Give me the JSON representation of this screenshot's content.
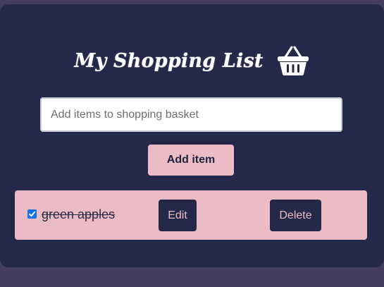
{
  "header": {
    "title": "My Shopping List",
    "icon": "basket-icon"
  },
  "form": {
    "input_value": "",
    "input_placeholder": "Add items to shopping basket",
    "add_label": "Add item"
  },
  "items": [
    {
      "text": "green apples",
      "checked": true,
      "edit_label": "Edit",
      "delete_label": "Delete"
    }
  ],
  "colors": {
    "page_background": "#453c62",
    "card_background": "#242849",
    "accent_pink": "#ecbcc6",
    "checkbox_blue": "#1473e6"
  }
}
